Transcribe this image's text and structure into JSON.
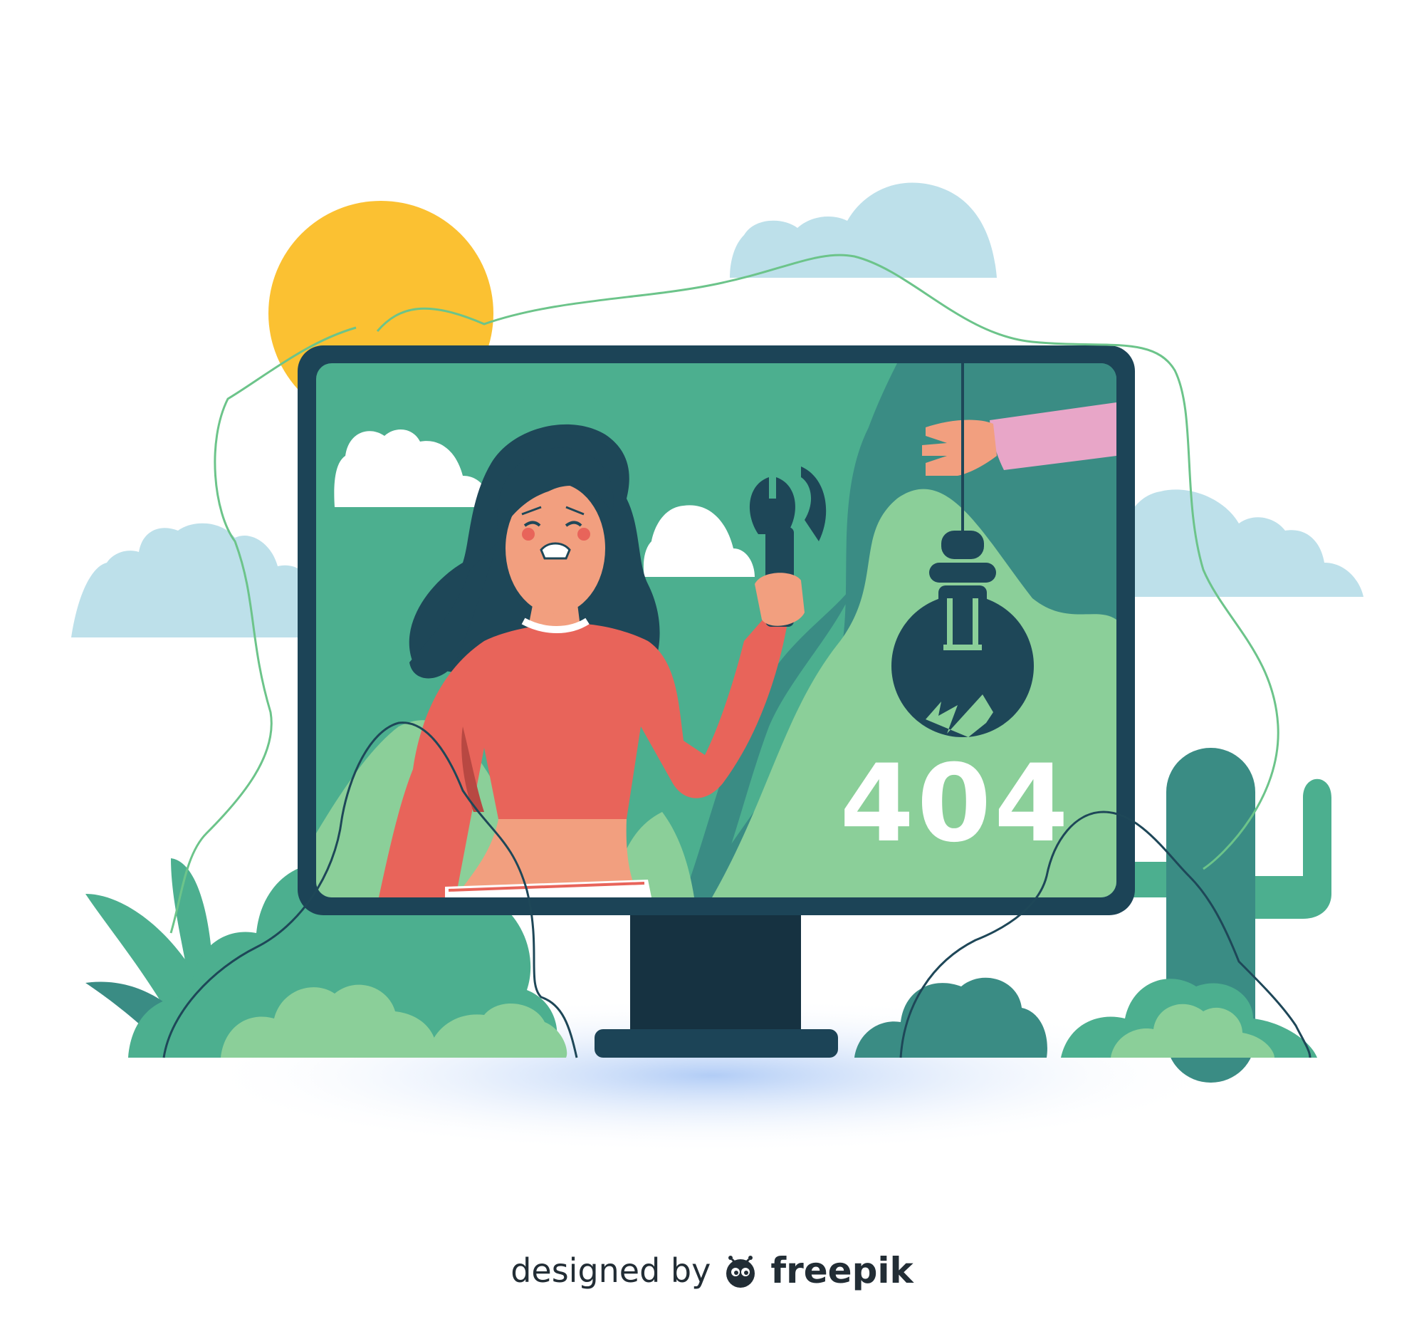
{
  "illustration": {
    "error_code": "404"
  },
  "credit": {
    "designed_by": "designed by",
    "brand": "freepik"
  },
  "colors": {
    "monitor_frame": "#1c4457",
    "screen_green": "#4caf8f",
    "screen_light_green": "#8bcf99",
    "screen_dark_teal": "#3a8c84",
    "sun": "#fbc132",
    "cloud_blue": "#bde0ea",
    "shirt": "#e8645a",
    "skin": "#f29f7f",
    "sleeve_pink": "#e8a6c8",
    "hair": "#1e4758",
    "ground_glow": "#a9c7f5"
  },
  "icons": [
    "wrench-icon",
    "broken-lightbulb-icon",
    "freepik-logo-icon"
  ]
}
